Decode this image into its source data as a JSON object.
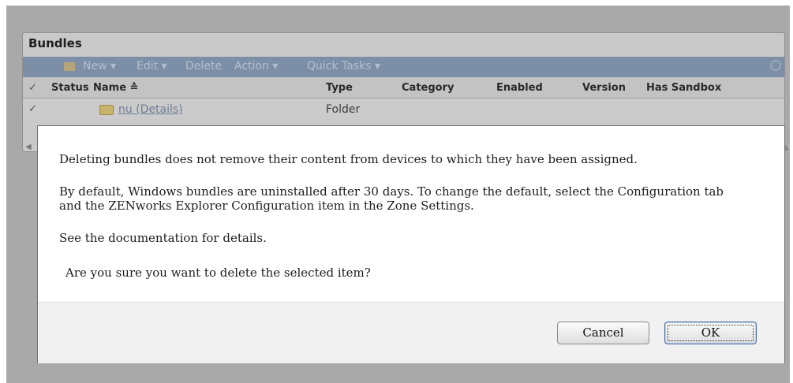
{
  "panel": {
    "title": "Bundles",
    "toolbar": {
      "new_label": "New ▾",
      "edit_label": "Edit ▾",
      "delete_label": "Delete",
      "action_label": "Action ▾",
      "quick_tasks_label": "Quick Tasks ▾"
    },
    "columns": {
      "check": "✓",
      "status": "Status",
      "name": "Name ≙",
      "type": "Type",
      "category": "Category",
      "enabled": "Enabled",
      "version": "Version",
      "has_sandbox": "Has Sandbox"
    },
    "row": {
      "check": "✓",
      "name": "nu (Details)",
      "type": "Folder"
    },
    "pager_arrow": "◀",
    "pager_tail": "s"
  },
  "dialog": {
    "line1": "Deleting bundles does not remove their content from devices to which they have been assigned.",
    "line2a": "By default, Windows bundles are uninstalled after 30 days. To change the default, select the Configuration tab",
    "line2b": "and the ZENworks Explorer Configuration item in the Zone Settings.",
    "line3": "See the documentation for details.",
    "question": "Are you sure you want to delete the selected item?",
    "cancel_label": "Cancel",
    "ok_label": "OK"
  }
}
